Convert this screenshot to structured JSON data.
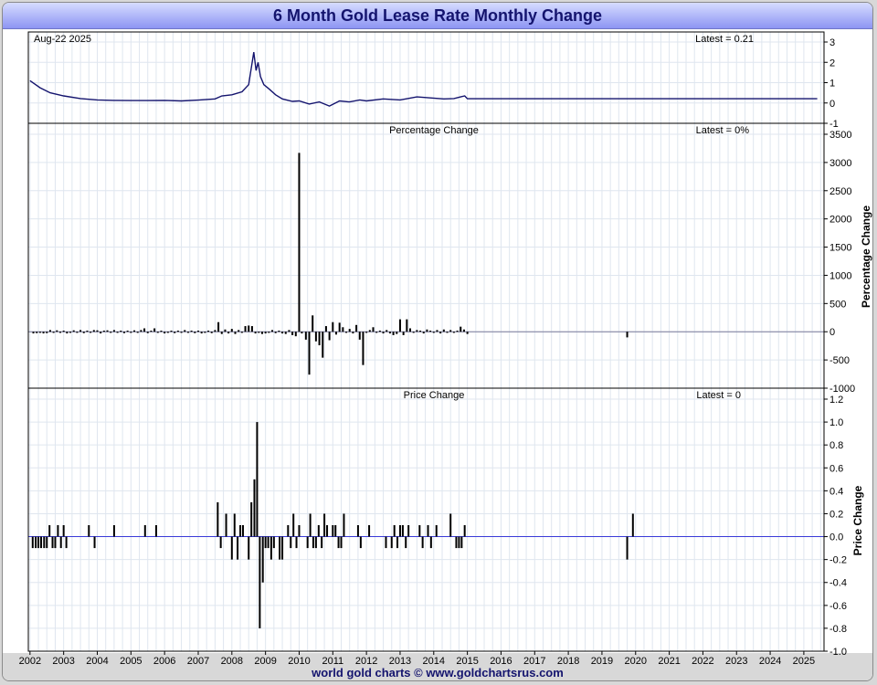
{
  "title": "6 Month Gold Lease Rate Monthly Change",
  "footer": "world gold charts © www.goldchartsrus.com",
  "colors": {
    "title_text": "#14146e",
    "line": "#14146e",
    "bar": "#000000",
    "zero_line_pct": "#7a7a9a",
    "zero_line_price": "#3a3ad8",
    "grid": "#dfe6ef"
  },
  "chart_data": [
    {
      "type": "line",
      "panel": "rate",
      "label_left": "Aug-22  2025",
      "label_latest": "Latest = 0.21",
      "ylim": [
        -1,
        3
      ],
      "yticks": [
        3,
        2,
        1,
        0,
        -1
      ],
      "x": [
        2002.0,
        2002.3,
        2002.6,
        2003.0,
        2003.5,
        2004.0,
        2004.5,
        2005.0,
        2005.5,
        2006.0,
        2006.5,
        2007.0,
        2007.5,
        2007.7,
        2008.0,
        2008.3,
        2008.5,
        2008.65,
        2008.72,
        2008.78,
        2008.85,
        2008.95,
        2009.1,
        2009.3,
        2009.5,
        2009.8,
        2010.0,
        2010.3,
        2010.6,
        2010.9,
        2011.2,
        2011.5,
        2011.8,
        2012.0,
        2012.5,
        2013.0,
        2013.5,
        2013.9,
        2014.3,
        2014.6,
        2014.8,
        2014.92,
        2015.0,
        2016.0,
        2018.0,
        2020.0,
        2022.0,
        2024.0,
        2025.4
      ],
      "y": [
        1.1,
        0.75,
        0.5,
        0.35,
        0.22,
        0.15,
        0.13,
        0.12,
        0.12,
        0.13,
        0.1,
        0.14,
        0.2,
        0.35,
        0.4,
        0.55,
        0.9,
        2.5,
        1.6,
        2.0,
        1.3,
        0.9,
        0.7,
        0.4,
        0.2,
        0.08,
        0.1,
        -0.05,
        0.05,
        -0.15,
        0.1,
        0.05,
        0.15,
        0.1,
        0.2,
        0.15,
        0.3,
        0.25,
        0.2,
        0.22,
        0.3,
        0.35,
        0.21,
        0.21,
        0.21,
        0.21,
        0.21,
        0.21,
        0.21
      ]
    },
    {
      "type": "bar",
      "panel": "pct",
      "title": "Percentage Change",
      "label_latest": "Latest = 0%",
      "ylabel": "Percentage Change",
      "ylim": [
        -1000,
        3500
      ],
      "yticks": [
        3500,
        3000,
        2500,
        2000,
        1500,
        1000,
        500,
        0,
        -500,
        -1000
      ],
      "x": [
        2002.1,
        2002.2,
        2002.3,
        2002.4,
        2002.5,
        2002.6,
        2002.7,
        2002.8,
        2002.9,
        2003.0,
        2003.1,
        2003.2,
        2003.3,
        2003.4,
        2003.5,
        2003.6,
        2003.7,
        2003.8,
        2003.9,
        2004.0,
        2004.1,
        2004.2,
        2004.3,
        2004.4,
        2004.5,
        2004.6,
        2004.7,
        2004.8,
        2004.9,
        2005.0,
        2005.1,
        2005.2,
        2005.3,
        2005.4,
        2005.5,
        2005.6,
        2005.7,
        2005.8,
        2005.9,
        2006.0,
        2006.1,
        2006.2,
        2006.3,
        2006.4,
        2006.5,
        2006.6,
        2006.7,
        2006.8,
        2006.9,
        2007.0,
        2007.1,
        2007.2,
        2007.3,
        2007.4,
        2007.5,
        2007.6,
        2007.7,
        2007.8,
        2007.9,
        2008.0,
        2008.1,
        2008.2,
        2008.3,
        2008.4,
        2008.5,
        2008.6,
        2008.7,
        2008.8,
        2008.9,
        2009.0,
        2009.1,
        2009.2,
        2009.3,
        2009.4,
        2009.5,
        2009.6,
        2009.7,
        2009.8,
        2009.9,
        2010.0,
        2010.08,
        2010.2,
        2010.3,
        2010.4,
        2010.5,
        2010.6,
        2010.7,
        2010.8,
        2010.9,
        2011.0,
        2011.1,
        2011.2,
        2011.3,
        2011.4,
        2011.5,
        2011.6,
        2011.7,
        2011.8,
        2011.9,
        2012.0,
        2012.1,
        2012.2,
        2012.3,
        2012.4,
        2012.5,
        2012.6,
        2012.7,
        2012.8,
        2012.9,
        2013.0,
        2013.1,
        2013.2,
        2013.3,
        2013.4,
        2013.5,
        2013.6,
        2013.7,
        2013.8,
        2013.9,
        2014.0,
        2014.1,
        2014.2,
        2014.3,
        2014.4,
        2014.5,
        2014.6,
        2014.7,
        2014.8,
        2014.9,
        2015.0,
        2019.75
      ],
      "values": [
        -30,
        -25,
        -20,
        -30,
        -25,
        30,
        -20,
        25,
        -20,
        20,
        -30,
        -20,
        25,
        -20,
        30,
        -25,
        20,
        -20,
        30,
        25,
        -30,
        20,
        25,
        -20,
        30,
        -20,
        20,
        -25,
        20,
        -20,
        25,
        -20,
        30,
        60,
        -25,
        20,
        60,
        -20,
        20,
        -30,
        -20,
        20,
        -25,
        20,
        -20,
        30,
        -20,
        20,
        -25,
        20,
        -30,
        -20,
        20,
        -25,
        30,
        170,
        -40,
        40,
        -30,
        50,
        -40,
        30,
        -20,
        100,
        110,
        100,
        -30,
        -20,
        -40,
        -30,
        -20,
        30,
        -25,
        20,
        -30,
        -40,
        30,
        -60,
        -80,
        3170,
        -30,
        -140,
        -760,
        290,
        -170,
        -240,
        -460,
        100,
        -150,
        170,
        -50,
        160,
        80,
        -20,
        50,
        -30,
        120,
        -140,
        -590,
        -20,
        30,
        80,
        -20,
        20,
        -30,
        30,
        -30,
        -60,
        -40,
        220,
        -60,
        220,
        60,
        -20,
        30,
        20,
        -30,
        40,
        20,
        -20,
        30,
        -30,
        40,
        -20,
        30,
        -20,
        20,
        90,
        40,
        -40,
        -100
      ]
    },
    {
      "type": "bar",
      "panel": "price",
      "title": "Price Change",
      "label_latest": "Latest = 0",
      "ylabel": "Price Change",
      "ylim": [
        -1.0,
        1.2
      ],
      "yticks": [
        1.2,
        1.0,
        0.8,
        0.6,
        0.4,
        0.2,
        0.0,
        -0.2,
        -0.4,
        -0.6,
        -0.8,
        -1.0
      ],
      "xlim": [
        2001.95,
        2025.6
      ],
      "xticks": [
        2002,
        2003,
        2004,
        2005,
        2006,
        2007,
        2008,
        2009,
        2010,
        2011,
        2012,
        2013,
        2014,
        2015,
        2016,
        2017,
        2018,
        2019,
        2020,
        2021,
        2022,
        2023,
        2024,
        2025
      ],
      "x": [
        2002.08,
        2002.17,
        2002.25,
        2002.33,
        2002.42,
        2002.5,
        2002.58,
        2002.67,
        2002.75,
        2002.83,
        2002.92,
        2003.0,
        2003.08,
        2003.75,
        2003.92,
        2004.5,
        2005.42,
        2005.75,
        2007.58,
        2007.67,
        2007.83,
        2008.0,
        2008.08,
        2008.17,
        2008.25,
        2008.33,
        2008.5,
        2008.58,
        2008.67,
        2008.75,
        2008.83,
        2008.92,
        2009.0,
        2009.08,
        2009.17,
        2009.25,
        2009.42,
        2009.5,
        2009.67,
        2009.75,
        2009.83,
        2009.92,
        2010.0,
        2010.25,
        2010.33,
        2010.42,
        2010.5,
        2010.58,
        2010.67,
        2010.75,
        2010.83,
        2011.0,
        2011.08,
        2011.17,
        2011.25,
        2011.33,
        2011.75,
        2011.83,
        2012.08,
        2012.58,
        2012.75,
        2012.83,
        2012.92,
        2013.0,
        2013.08,
        2013.17,
        2013.25,
        2013.58,
        2013.67,
        2013.83,
        2013.92,
        2014.08,
        2014.5,
        2014.67,
        2014.75,
        2014.83,
        2014.92,
        2019.75,
        2019.92
      ],
      "values": [
        -0.1,
        -0.1,
        -0.1,
        -0.1,
        -0.1,
        -0.1,
        0.1,
        -0.1,
        -0.1,
        0.1,
        -0.1,
        0.1,
        -0.1,
        0.1,
        -0.1,
        0.1,
        0.1,
        0.1,
        0.3,
        -0.1,
        0.2,
        -0.2,
        0.2,
        -0.2,
        0.1,
        0.1,
        -0.2,
        0.3,
        0.5,
        1.0,
        -0.8,
        -0.4,
        -0.1,
        -0.1,
        -0.2,
        -0.1,
        -0.2,
        -0.2,
        0.1,
        -0.1,
        0.2,
        -0.1,
        0.1,
        -0.1,
        0.2,
        -0.1,
        -0.1,
        0.1,
        -0.1,
        0.2,
        0.1,
        0.1,
        0.1,
        -0.1,
        -0.1,
        0.2,
        0.1,
        -0.1,
        0.1,
        -0.1,
        -0.1,
        0.1,
        -0.1,
        0.1,
        0.1,
        -0.1,
        0.1,
        0.1,
        -0.1,
        0.1,
        -0.1,
        0.1,
        0.2,
        -0.1,
        -0.1,
        -0.1,
        0.1,
        -0.2,
        0.2
      ]
    }
  ]
}
